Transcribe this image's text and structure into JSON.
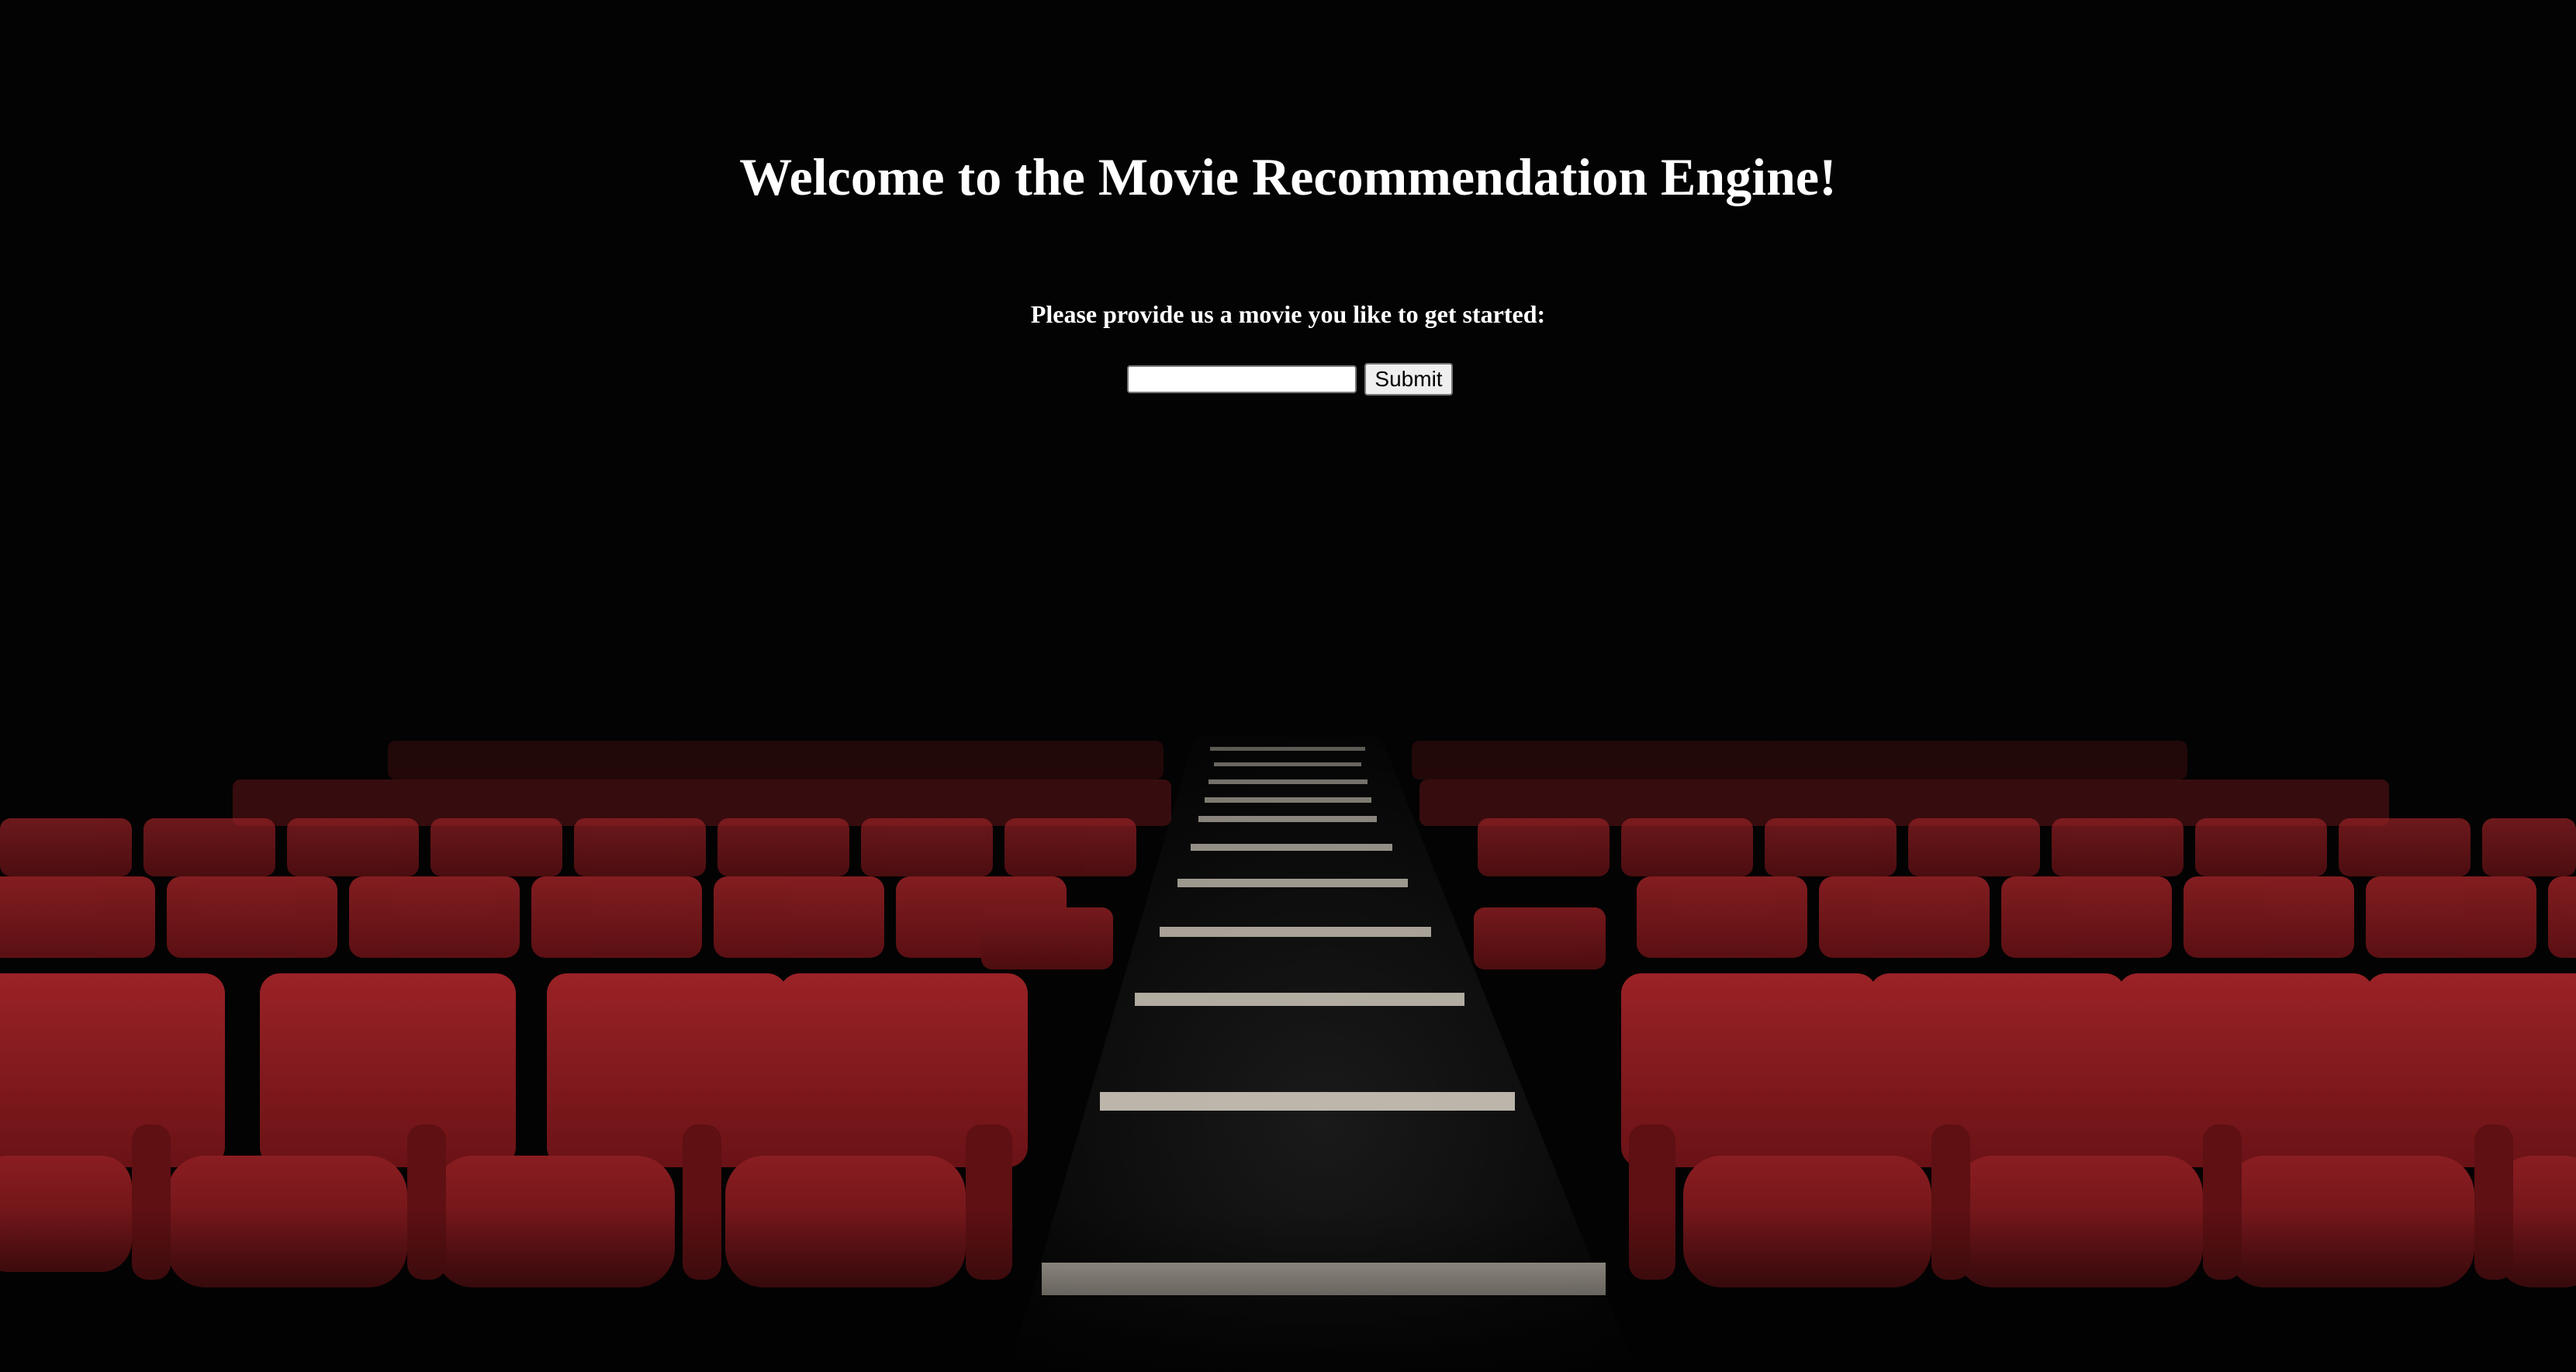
{
  "header": {
    "title": "Welcome to the Movie Recommendation Engine!"
  },
  "form": {
    "prompt": "Please provide us a movie you like to get started:",
    "movie_input_value": "",
    "submit_label": "Submit"
  },
  "colors": {
    "background": "#030303",
    "text": "#ffffff",
    "seat_red": "#8e1c20",
    "step_light": "#c9c2b6"
  }
}
